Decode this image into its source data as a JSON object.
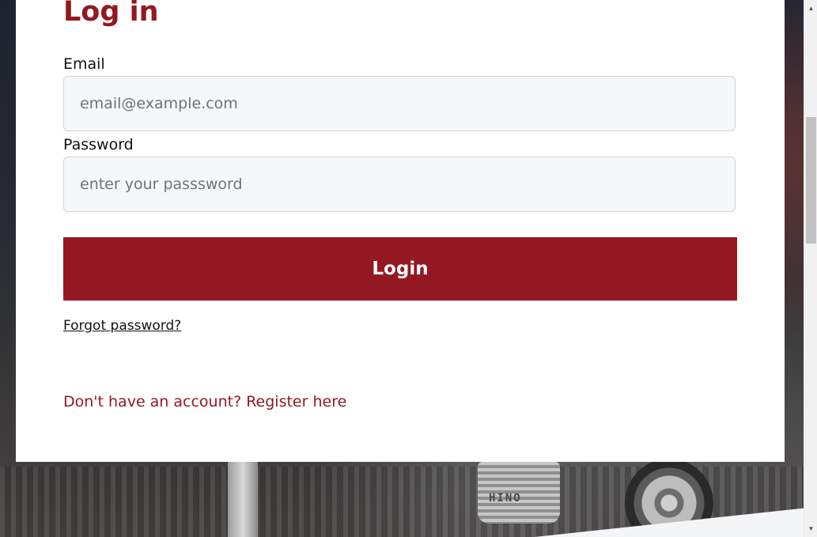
{
  "login_form": {
    "title": "Log in",
    "email_label": "Email",
    "email_placeholder": "email@example.com",
    "email_value": "",
    "password_label": "Password",
    "password_placeholder": "enter your passsword",
    "password_value": "",
    "login_button_label": "Login",
    "forgot_password_link": "Forgot password?",
    "register_link": "Don't have an account? Register here"
  },
  "background": {
    "grille_badge": "HINO"
  },
  "scrollbar": {
    "up_icon": "chevron-up-icon",
    "down_icon": "chevron-down-icon"
  },
  "colors": {
    "brand": "#941821",
    "card_bg": "#ffffff",
    "input_bg": "#f6f7f9"
  }
}
